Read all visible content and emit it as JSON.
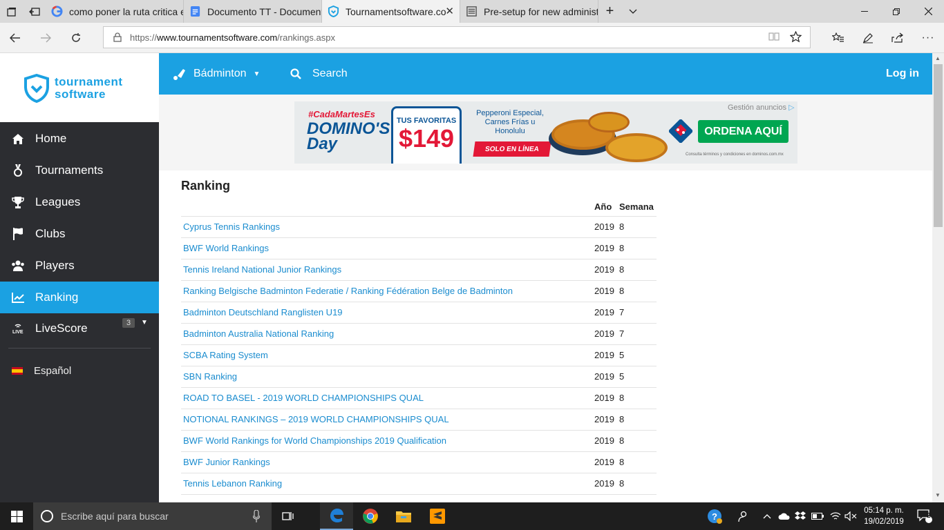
{
  "browser": {
    "tabs": [
      {
        "title": "como poner la ruta critica e",
        "active": false
      },
      {
        "title": "Documento TT - Document",
        "active": false
      },
      {
        "title": "Tournamentsoftware.co",
        "active": true
      },
      {
        "title": "Pre-setup for new administ",
        "active": false
      }
    ],
    "url_prefix": "https://",
    "url_domain": "www.tournamentsoftware.com",
    "url_path": "/rankings.aspx"
  },
  "logo": {
    "line1": "tournament",
    "line2": "software"
  },
  "sidebar": {
    "items": [
      {
        "label": "Home",
        "icon": "home-icon"
      },
      {
        "label": "Tournaments",
        "icon": "medal-icon"
      },
      {
        "label": "Leagues",
        "icon": "trophy-icon"
      },
      {
        "label": "Clubs",
        "icon": "flag-icon"
      },
      {
        "label": "Players",
        "icon": "users-icon"
      },
      {
        "label": "Ranking",
        "icon": "chart-line-icon",
        "active": true
      },
      {
        "label": "LiveScore",
        "icon": "live-icon",
        "badge": "3"
      }
    ],
    "language": "Español"
  },
  "topbar": {
    "sport": "Bádminton",
    "search": "Search",
    "login": "Log in"
  },
  "ad": {
    "hashtag": "#CadaMartesEs",
    "brand_day": "DOMINO'S Day",
    "card_title": "TUS FAVORITAS",
    "price": "$149",
    "menu": "Pepperoni Especial, Carnes Frías u Honolulu",
    "online": "SOLO EN LÍNEA",
    "order": "ORDENA AQUÍ",
    "legal": "Consulta términos y condiciones en dominos.com.mx",
    "manage": "Gestión anuncios"
  },
  "ranking": {
    "title": "Ranking",
    "col_year": "Año",
    "col_week": "Semana",
    "rows": [
      {
        "name": "Cyprus Tennis Rankings",
        "year": "2019",
        "week": "8"
      },
      {
        "name": "BWF World Rankings",
        "year": "2019",
        "week": "8"
      },
      {
        "name": "Tennis Ireland National Junior Rankings",
        "year": "2019",
        "week": "8"
      },
      {
        "name": "Ranking Belgische Badminton Federatie / Ranking Fédération Belge de Badminton",
        "year": "2019",
        "week": "8"
      },
      {
        "name": "Badminton Deutschland Ranglisten U19",
        "year": "2019",
        "week": "7"
      },
      {
        "name": "Badminton Australia National Ranking",
        "year": "2019",
        "week": "7"
      },
      {
        "name": "SCBA Rating System",
        "year": "2019",
        "week": "5"
      },
      {
        "name": "SBN Ranking",
        "year": "2019",
        "week": "5"
      },
      {
        "name": "ROAD TO BASEL - 2019 WORLD CHAMPIONSHIPS QUAL",
        "year": "2019",
        "week": "8"
      },
      {
        "name": "NOTIONAL RANKINGS – 2019 WORLD CHAMPIONSHIPS QUAL",
        "year": "2019",
        "week": "8"
      },
      {
        "name": "BWF World Rankings for World Championships 2019 Qualification",
        "year": "2019",
        "week": "8"
      },
      {
        "name": "BWF Junior Rankings",
        "year": "2019",
        "week": "8"
      },
      {
        "name": "Tennis Lebanon Ranking",
        "year": "2019",
        "week": "8"
      }
    ]
  },
  "taskbar": {
    "search_placeholder": "Escribe aquí para buscar",
    "time": "05:14 p. m.",
    "date": "19/02/2019",
    "notifications": "2"
  }
}
